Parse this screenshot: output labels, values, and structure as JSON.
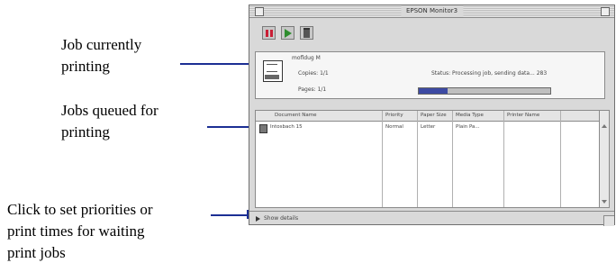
{
  "callouts": {
    "current_job": [
      "Job currently",
      "printing"
    ],
    "queued": [
      "Jobs queued for",
      "printing"
    ],
    "details": [
      "Click to set priorities or",
      "print times for waiting",
      "print jobs"
    ]
  },
  "window": {
    "title": "EPSON Monitor3",
    "toolbar": {
      "pause_icon": "pause-icon",
      "resume_icon": "play-icon",
      "delete_icon": "trash-icon",
      "pause_color": "#c91f36",
      "resume_color": "#2f8d2f"
    },
    "current_job": {
      "icon": "printer-icon",
      "name": "mofldug M",
      "copies": "Copies: 1/1",
      "pages": "Pages: 1/1",
      "status": "Status: Processing job, sending data... 283",
      "progress": 0.22,
      "progress_color": "#3d4aa3"
    },
    "queue": {
      "columns": [
        "Document Name",
        "Priority",
        "Paper Size",
        "Media Type",
        "Printer Name"
      ],
      "rows": [
        [
          "Intosbach 15",
          "Normal",
          "Letter",
          "Plain Pa...",
          ""
        ]
      ]
    },
    "details": {
      "label": "Show details",
      "icon": "disclosure-triangle-icon"
    }
  }
}
